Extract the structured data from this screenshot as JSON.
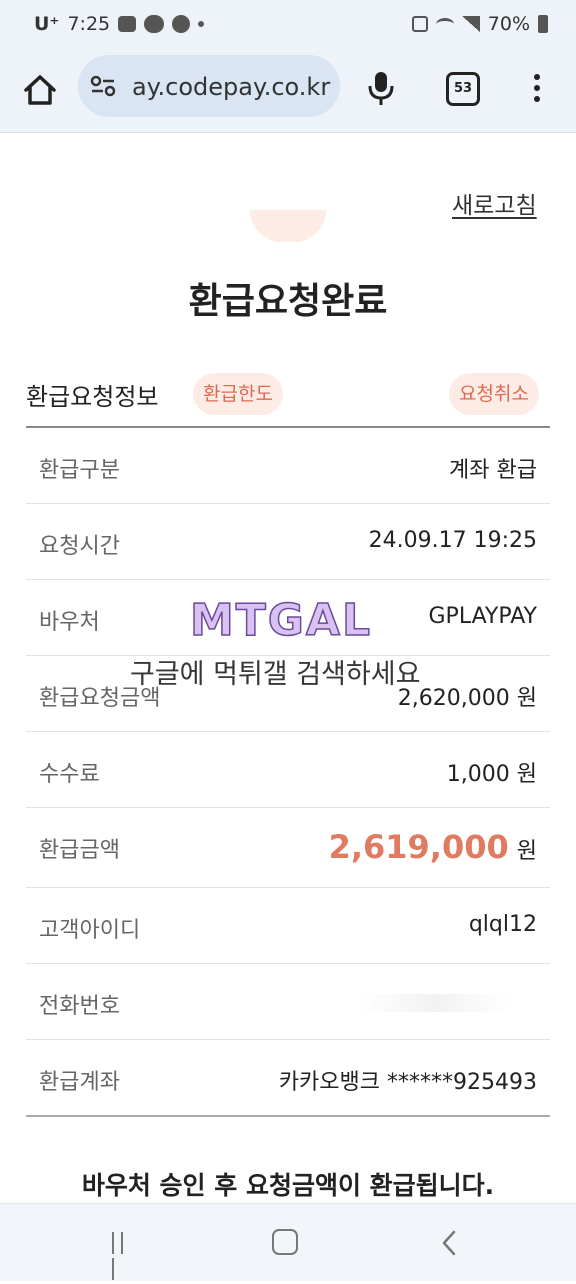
{
  "status_bar": {
    "carrier": "U⁺",
    "time": "7:25",
    "battery": "70%"
  },
  "browser": {
    "url": "ay.codepay.co.kr",
    "tab_count": "53"
  },
  "page": {
    "refresh_label": "새로고침",
    "title": "환급요청완료",
    "section_title": "환급요청정보",
    "limit_chip": "환급한도",
    "cancel_chip": "요청취소",
    "rows": [
      {
        "label": "환급구분",
        "value": "계좌 환급"
      },
      {
        "label": "요청시간",
        "value": "24.09.17 19:25"
      },
      {
        "label": "바우처",
        "value": "GPLAYPAY"
      },
      {
        "label": "환급요청금액",
        "value": "2,620,000 원"
      },
      {
        "label": "수수료",
        "value": "1,000 원"
      },
      {
        "label": "환급금액",
        "amount": "2,619,000",
        "unit": "원"
      },
      {
        "label": "고객아이디",
        "value": "qlql12"
      },
      {
        "label": "전화번호",
        "value": ""
      },
      {
        "label": "환급계좌",
        "value": "카카오뱅크 ******925493"
      }
    ],
    "notice": "바우처 승인 후 요청금액이 환급됩니다."
  },
  "watermark": {
    "logo_text": "MTGAL",
    "text": "구글에 먹튀갤 검색하세요"
  },
  "colors": {
    "accent": "#e07a60",
    "chip_bg": "#fdebe6",
    "chrome_bg": "#eef3f9"
  }
}
